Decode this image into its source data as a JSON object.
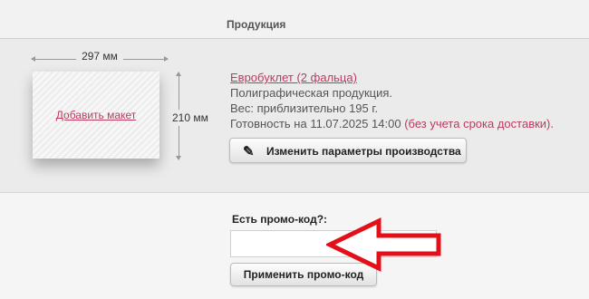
{
  "header": {
    "title": "Продукция"
  },
  "product": {
    "width_label": "297 мм",
    "height_label": "210 мм",
    "add_maket": "Добавить макет",
    "name": "Евробуклет (2 фальца)",
    "category": "Полиграфическая продукция.",
    "weight": "Вес: приблизительно 195 г.",
    "ready_prefix": "Готовность на 11.07.2025 14:00",
    "ready_note": "(без учета срока доставки)",
    "ready_suffix": ".",
    "change_button": "Изменить параметры производства"
  },
  "promo": {
    "label": "Есть промо-код?:",
    "input_value": "",
    "apply_button": "Применить промо-код"
  },
  "colors": {
    "accent": "#c0395e",
    "annotation_arrow": "#e3101a"
  },
  "icons": {
    "pencil": "pencil-icon"
  }
}
